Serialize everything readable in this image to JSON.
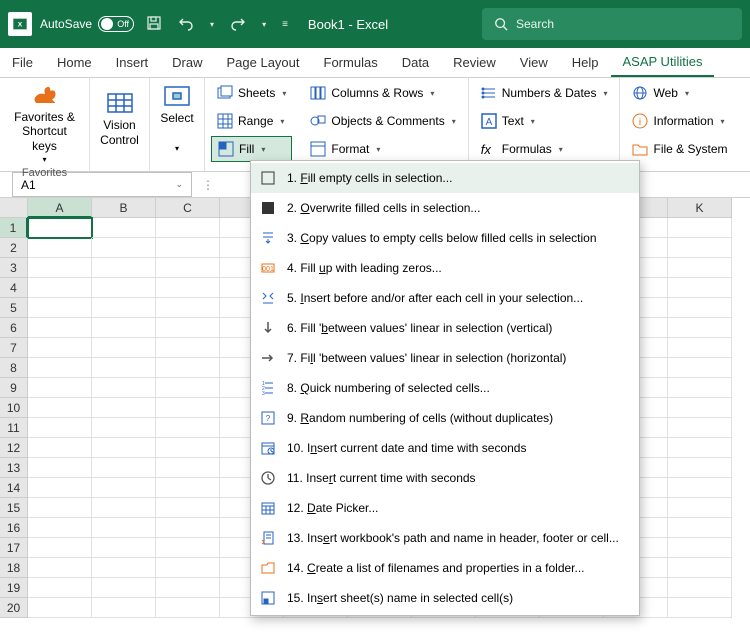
{
  "titlebar": {
    "autosave_label": "AutoSave",
    "autosave_state": "Off",
    "title": "Book1  -  Excel",
    "search_placeholder": "Search"
  },
  "tabs": [
    "File",
    "Home",
    "Insert",
    "Draw",
    "Page Layout",
    "Formulas",
    "Data",
    "Review",
    "View",
    "Help",
    "ASAP Utilities"
  ],
  "active_tab": "ASAP Utilities",
  "ribbon": {
    "favorites": {
      "big1": "Favorites &\nShortcut keys",
      "label": "Favorites"
    },
    "vision": "Vision\nControl",
    "select": "Select",
    "col1": [
      "Sheets",
      "Range",
      "Fill"
    ],
    "col2": [
      "Columns & Rows",
      "Objects & Comments",
      "Format"
    ],
    "col3": [
      "Numbers & Dates",
      "Text",
      "Formulas"
    ],
    "col4": [
      "Web",
      "Information",
      "File & System"
    ]
  },
  "namebox": "A1",
  "columns_visible": [
    "A",
    "B",
    "C",
    "",
    "",
    "",
    "",
    "",
    "",
    "",
    "K"
  ],
  "rows_visible": 20,
  "fill_menu": [
    {
      "n": "1.",
      "label": "Fill empty cells in selection...",
      "key": "F"
    },
    {
      "n": "2.",
      "label": "Overwrite filled cells in selection...",
      "key": "O"
    },
    {
      "n": "3.",
      "label": "Copy values to empty cells below filled cells in selection",
      "key": "C"
    },
    {
      "n": "4.",
      "label": "Fill up with leading zeros...",
      "key": "u"
    },
    {
      "n": "5.",
      "label": "Insert before and/or after each cell in your selection...",
      "key": "I"
    },
    {
      "n": "6.",
      "label": "Fill 'between values' linear in selection (vertical)",
      "key": "b"
    },
    {
      "n": "7.",
      "label": "Fill 'between values' linear in selection (horizontal)",
      "key": "l"
    },
    {
      "n": "8.",
      "label": "Quick numbering of selected cells...",
      "key": "Q"
    },
    {
      "n": "9.",
      "label": "Random numbering of cells (without duplicates)",
      "key": "R"
    },
    {
      "n": "10.",
      "label": "Insert current date and time with seconds",
      "key": "n"
    },
    {
      "n": "11.",
      "label": "Insert current time with seconds",
      "key": "r"
    },
    {
      "n": "12.",
      "label": "Date Picker...",
      "key": "D"
    },
    {
      "n": "13.",
      "label": "Insert workbook's path and name in header, footer or cell...",
      "key": "e"
    },
    {
      "n": "14.",
      "label": "Create a list of filenames and properties in a folder...",
      "key": "C"
    },
    {
      "n": "15.",
      "label": "Insert sheet(s) name in selected cell(s)",
      "key": "s"
    }
  ]
}
